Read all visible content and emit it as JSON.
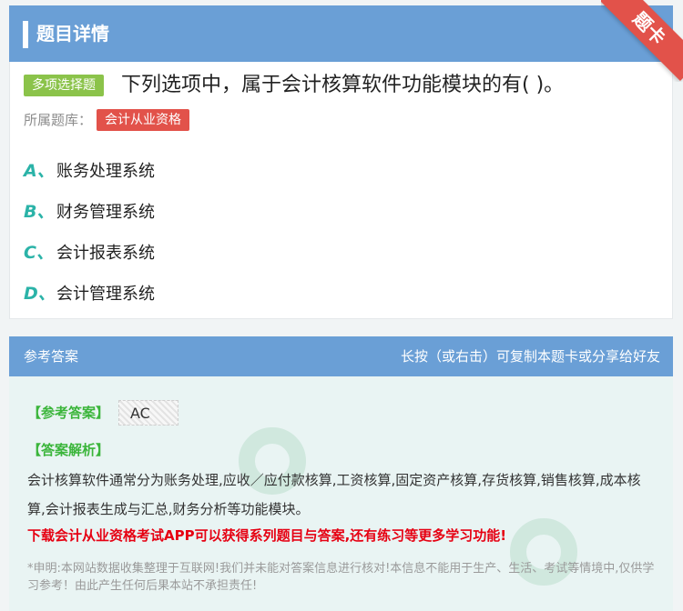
{
  "header": {
    "title": "题目详情",
    "ribbon": "题卡"
  },
  "question": {
    "type_tag": "多项选择题",
    "text": "下列选项中，属于会计核算软件功能模块的有( )。",
    "bank_label": "所属题库：",
    "bank_tag": "会计从业资格"
  },
  "options": [
    {
      "letter": "A、",
      "text": "账务处理系统"
    },
    {
      "letter": "B、",
      "text": "财务管理系统"
    },
    {
      "letter": "C、",
      "text": "会计报表系统"
    },
    {
      "letter": "D、",
      "text": "会计管理系统"
    }
  ],
  "answer": {
    "header_left": "参考答案",
    "header_right": "长按（或右击）可复制本题卡或分享给好友",
    "answer_label": "【参考答案】",
    "answer_value": "AC",
    "analysis_label": "【答案解析】",
    "analysis_text": "会计核算软件通常分为账务处理,应收／应付款核算,工资核算,固定资产核算,存货核算,销售核算,成本核算,会计报表生成与汇总,财务分析等功能模块。",
    "promo": "下载会计从业资格考试APP可以获得系列题目与答案,还有练习等更多学习功能!",
    "disclaimer": "*申明:本网站数据收集整理于互联网!我们并未能对答案信息进行核对!本信息不能用于生产、生活、考试等情境中,仅供学习参考！由此产生任何后果本站不承担责任!"
  },
  "colors": {
    "header": "#6a9fd6",
    "ribbon": "#e2524a",
    "type_tag": "#8bc34a",
    "letter": "#2bb3a8",
    "promo": "#e60012"
  }
}
